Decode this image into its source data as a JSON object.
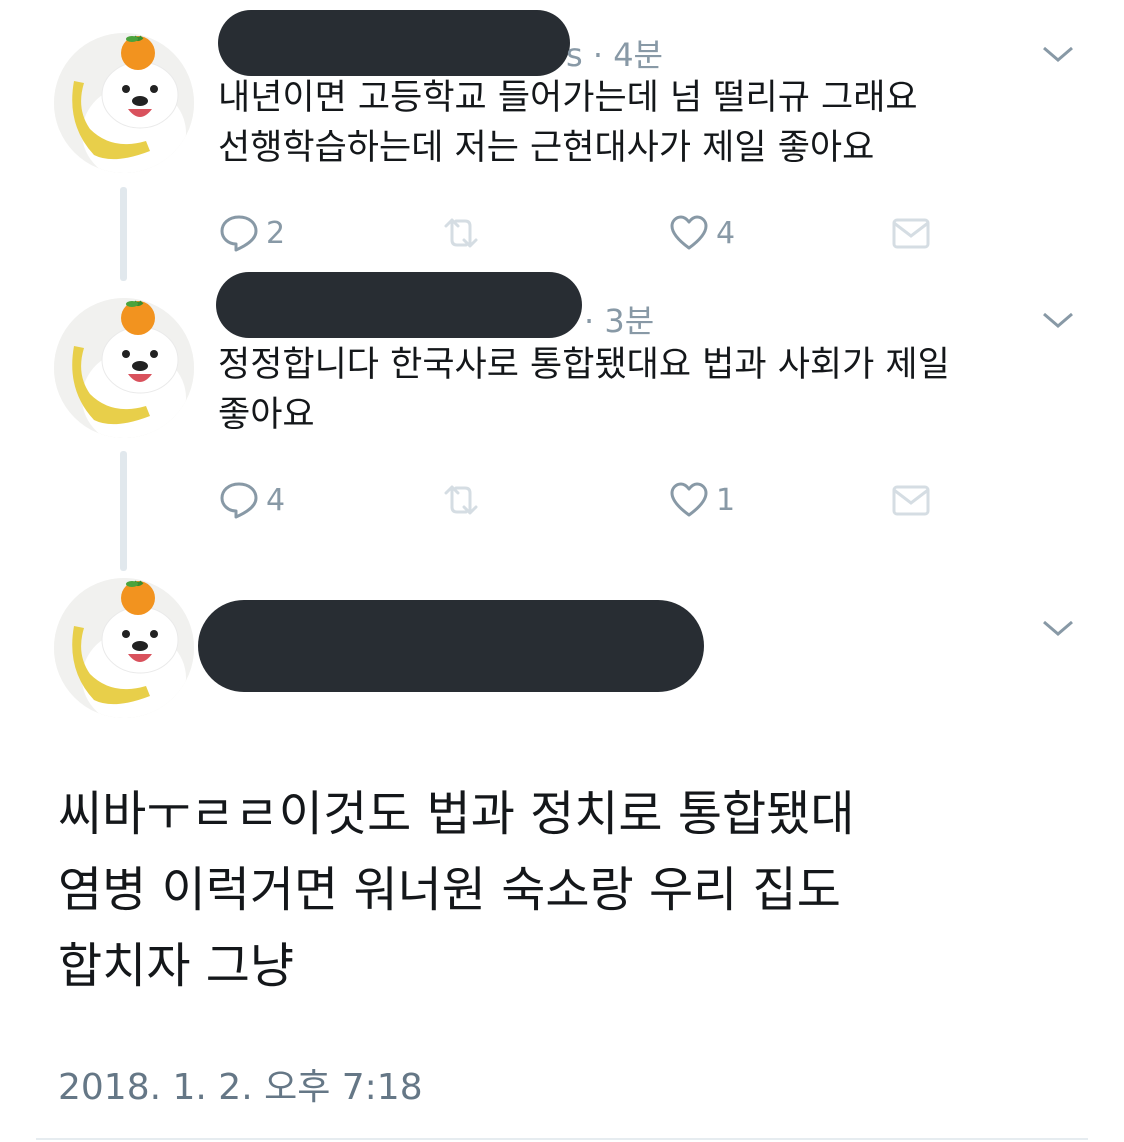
{
  "tweets": [
    {
      "time": "4분",
      "name_tail": "s",
      "lines": [
        "내년이면 고등학교 들어가는데 넘 떨리규 그래요",
        "선행학습하는데 저는 근현대사가 제일 좋아요"
      ],
      "reply_count": "2",
      "retweet_count": "",
      "like_count": "4"
    },
    {
      "time": "3분",
      "lines": [
        "정정합니다 한국사로 통합됐대요 법과 사회가 제일",
        "좋아요"
      ],
      "reply_count": "4",
      "retweet_count": "",
      "like_count": "1"
    }
  ],
  "main_tweet": {
    "lines": [
      "씨바ㅜㄹㄹ이것도 법과 정치로 통합됐대",
      "염병 이럭거면 워너원 숙소랑 우리 집도",
      "합치자 그냥"
    ],
    "timestamp": "2018. 1. 2. 오후 7:18"
  },
  "colors": {
    "text": "#14171a",
    "muted": "#8899a6",
    "redaction": "#282d33",
    "thread_line": "#e1e8ed"
  },
  "icons": [
    "reply-icon",
    "retweet-icon",
    "like-icon",
    "message-icon",
    "chevron-down-icon"
  ]
}
